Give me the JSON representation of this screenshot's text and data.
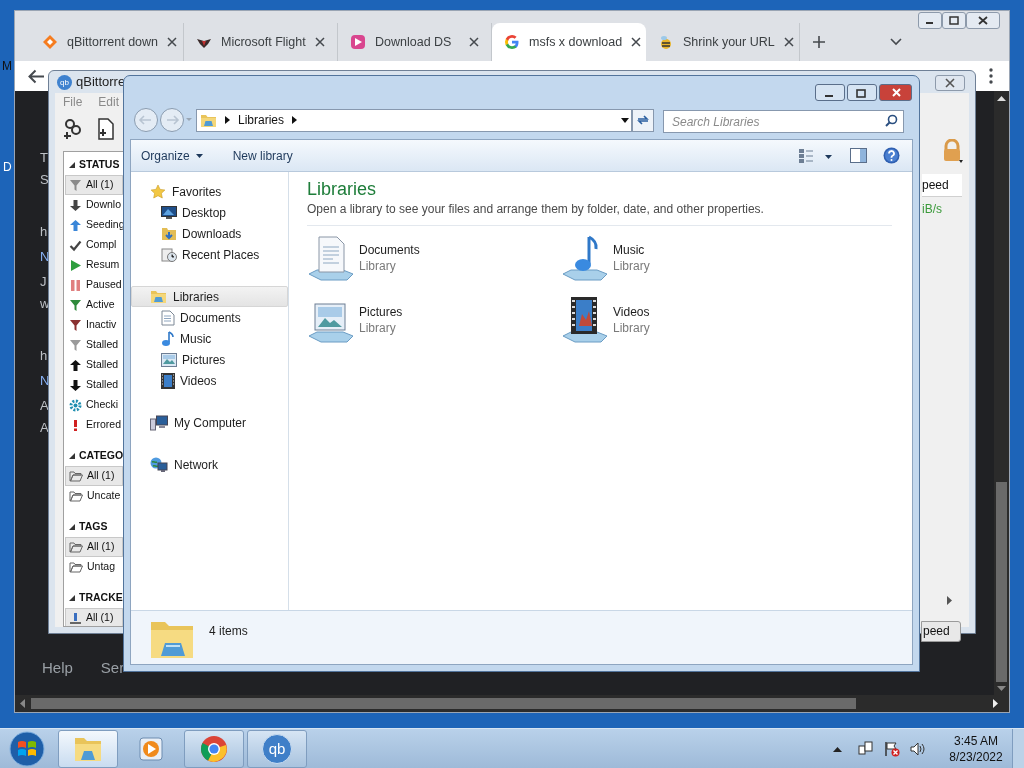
{
  "desktop": {
    "edge_labels": [
      "M",
      "D"
    ]
  },
  "browser": {
    "tabs": [
      {
        "title": "qBittorrent down",
        "selected": false
      },
      {
        "title": "Microsoft Flight",
        "selected": false
      },
      {
        "title": "Download DS",
        "selected": false
      },
      {
        "title": "msfs x download",
        "selected": true
      },
      {
        "title": "Shrink your URL",
        "selected": false
      }
    ],
    "page_fragments": [
      [
        {
          "text": "T",
          "kind": "text"
        },
        {
          "text": "S",
          "kind": "text"
        }
      ],
      [
        {
          "text": "h",
          "kind": "text"
        },
        {
          "text": "N",
          "kind": "heading"
        },
        {
          "text": "J",
          "kind": "text"
        },
        {
          "text": "w",
          "kind": "text"
        }
      ],
      [
        {
          "text": "h",
          "kind": "text"
        },
        {
          "text": "N",
          "kind": "heading"
        },
        {
          "text": "A",
          "kind": "text"
        },
        {
          "text": "A",
          "kind": "text"
        }
      ]
    ],
    "footer_links": [
      "Help",
      "Ser"
    ]
  },
  "qbittorrent": {
    "icon_text": "qb",
    "title": "qBittorre",
    "menu": [
      "File",
      "Edit"
    ],
    "filter_sections": [
      {
        "title": "STATUS",
        "items": [
          {
            "label": "All (1)",
            "selected": true
          },
          {
            "label": "Downlo",
            "selected": false
          },
          {
            "label": "Seeding",
            "selected": false
          },
          {
            "label": "Compl",
            "selected": false
          },
          {
            "label": "Resum",
            "selected": false
          },
          {
            "label": "Paused",
            "selected": false
          },
          {
            "label": "Active",
            "selected": false
          },
          {
            "label": "Inactiv",
            "selected": false
          },
          {
            "label": "Stalled",
            "selected": false
          },
          {
            "label": "Stalled",
            "selected": false
          },
          {
            "label": "Stalled",
            "selected": false
          },
          {
            "label": "Checki",
            "selected": false
          },
          {
            "label": "Errored",
            "selected": false
          }
        ]
      },
      {
        "title": "CATEGO",
        "items": [
          {
            "label": "All (1)",
            "selected": true
          },
          {
            "label": "Uncate",
            "selected": false
          }
        ]
      },
      {
        "title": "TAGS",
        "items": [
          {
            "label": "All (1)",
            "selected": true
          },
          {
            "label": "Untag",
            "selected": false
          }
        ]
      },
      {
        "title": "TRACKE",
        "items": [
          {
            "label": "All (1)",
            "selected": true
          }
        ]
      }
    ],
    "column_header": "peed",
    "speed_value": "iB/s",
    "button": "peed"
  },
  "explorer": {
    "address": [
      "Libraries"
    ],
    "search_placeholder": "Search Libraries",
    "commands": [
      {
        "label": "Organize",
        "dropdown": true
      },
      {
        "label": "New library",
        "dropdown": false
      }
    ],
    "navigation": [
      {
        "label": "Favorites",
        "selected": false,
        "children": [
          {
            "label": "Desktop",
            "selected": false
          },
          {
            "label": "Downloads",
            "selected": false
          },
          {
            "label": "Recent Places",
            "selected": false
          }
        ]
      },
      {
        "label": "Libraries",
        "selected": true,
        "children": [
          {
            "label": "Documents",
            "selected": false
          },
          {
            "label": "Music",
            "selected": false
          },
          {
            "label": "Pictures",
            "selected": false
          },
          {
            "label": "Videos",
            "selected": false
          }
        ]
      },
      {
        "label": "My Computer",
        "selected": false
      },
      {
        "label": "Network",
        "selected": false
      }
    ],
    "heading": "Libraries",
    "description": "Open a library to see your files and arrange them by folder, date, and other properties.",
    "libraries": [
      {
        "name": "Documents",
        "type": "Library"
      },
      {
        "name": "Music",
        "type": "Library"
      },
      {
        "name": "Pictures",
        "type": "Library"
      },
      {
        "name": "Videos",
        "type": "Library"
      }
    ],
    "item_count": "4 items"
  },
  "taskbar": {
    "buttons": [
      {
        "kind": "folder",
        "active": true,
        "running": true
      },
      {
        "kind": "player",
        "active": false,
        "running": false
      },
      {
        "kind": "browser",
        "active": false,
        "running": true
      },
      {
        "kind": "torrent",
        "active": false,
        "running": true,
        "label": "qb"
      }
    ],
    "clock": {
      "time": "3:45 AM",
      "date": "8/23/2022"
    }
  }
}
